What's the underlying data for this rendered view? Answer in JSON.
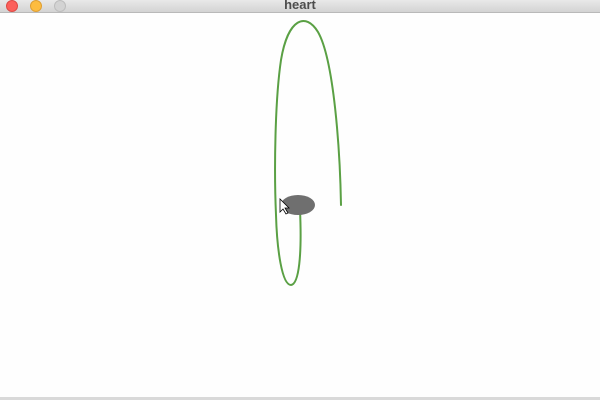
{
  "window": {
    "title": "heart"
  },
  "controls": {
    "close": "close-button",
    "minimize": "minimize-button",
    "maximize": "maximize-button"
  },
  "canvas": {
    "drawing_color": "#5aa044",
    "blob_color": "#6f6f6f"
  }
}
